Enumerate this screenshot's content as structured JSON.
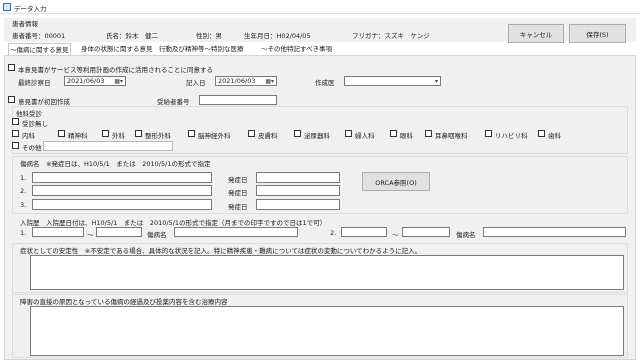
{
  "window": {
    "title": "データ入力"
  },
  "patient": {
    "section_title": "患者情報",
    "number": "患者番号：00001",
    "name": "氏名：鈴木　健二",
    "sex": "性別：男",
    "birthdate": "生年月日：H02/04/05",
    "kana": "フリガナ：スズキ　ケンジ"
  },
  "buttons": {
    "cancel": "キャンセル",
    "save": "保存(S)",
    "orca": "ORCA参照(O)"
  },
  "tabs": [
    "～傷病に関する意見",
    "身体の状態に関する意見",
    "行動及び精神等～特別な医療",
    "～その他特記すべき事項"
  ],
  "form": {
    "consent_label": "本意見書がサービス等利用計画の作成に活用されることに同意する",
    "last_exam_label": "最終診察日",
    "last_exam_value": "2021/06/03",
    "entry_date_label": "記入日",
    "entry_date_value": "2021/06/03",
    "doctor_label": "作成医",
    "first_time_label": "意見書が初回作成",
    "ticket_label": "受給者番号",
    "other_dept": {
      "title": "他科受診",
      "none_label": "受診無し",
      "departments": [
        "内科",
        "精神科",
        "外科",
        "整形外科",
        "脳神経外科",
        "皮膚科",
        "泌尿器科",
        "婦人科",
        "眼科",
        "耳鼻咽喉科",
        "リハビリ科",
        "歯科"
      ],
      "other_label": "その他"
    },
    "diagnosis": {
      "title": "傷病名　※発症日は、H10/5/1　または　2010/5/1の形式で指定",
      "rows": [
        "1.",
        "2.",
        "3."
      ],
      "onset_label": "発症日"
    },
    "hospital": {
      "title": "入院歴　入院歴日付は、H10/5/1　または　2010/5/1の形式で指定（月までの印字ですので日は1で可）",
      "row1": "1.",
      "row2": "2.",
      "tilde": "～",
      "disease_label": "傷病名"
    },
    "stability_label": "症状としての安定性　※不安定である場合、具体的な状況を記入。特に精神疾患・難病については症状の変動についてわかるように記入。",
    "treatment_label": "障害の直接の原因となっている傷病の経過及び投薬内容を含む治療内容"
  },
  "icons": {
    "calendar": "calendar-icon",
    "dropdown": "chevron-down-icon",
    "window": "window-icon"
  }
}
